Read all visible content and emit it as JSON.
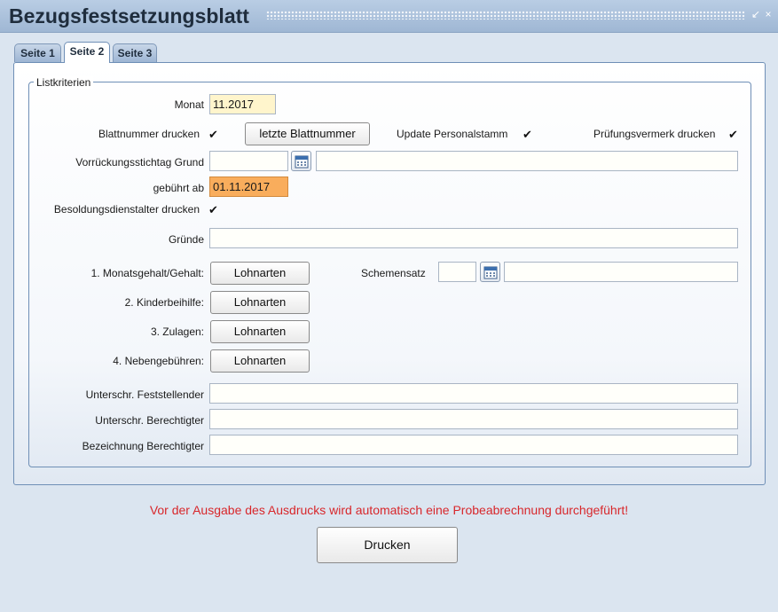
{
  "window": {
    "title": "Bezugsfestsetzungsblatt",
    "restore_glyph": "↙",
    "close_glyph": "×"
  },
  "tabs": [
    {
      "label": "Seite 1",
      "active": false
    },
    {
      "label": "Seite 2",
      "active": true
    },
    {
      "label": "Seite 3",
      "active": false
    }
  ],
  "listkriterien": {
    "legend": "Listkriterien",
    "monat": {
      "label": "Monat",
      "value": "11.2017"
    },
    "blattnummer_drucken": {
      "label": "Blattnummer drucken",
      "checked": true
    },
    "letzte_blattnummer_button": "letzte Blattnummer",
    "update_personalstamm": {
      "label": "Update Personalstamm",
      "checked": true
    },
    "pruefungsvermerk_drucken": {
      "label": "Prüfungsvermerk drucken",
      "checked": true
    },
    "vorrueckungsstichtag_grund": {
      "label": "Vorrückungsstichtag Grund",
      "date_value": "",
      "text_value": ""
    },
    "gebuehrt_ab": {
      "label": "gebührt ab",
      "value": "01.11.2017"
    },
    "besoldungsdienstalter_drucken": {
      "label": "Besoldungsdienstalter drucken",
      "checked": true
    },
    "gruende": {
      "label": "Gründe",
      "value": ""
    },
    "lohnarten_rows": [
      {
        "label": "1. Monatsgehalt/Gehalt:",
        "button": "Lohnarten"
      },
      {
        "label": "2. Kinderbeihilfe:",
        "button": "Lohnarten"
      },
      {
        "label": "3. Zulagen:",
        "button": "Lohnarten"
      },
      {
        "label": "4. Nebengebühren:",
        "button": "Lohnarten"
      }
    ],
    "schemensatz": {
      "label": "Schemensatz",
      "code_value": "",
      "text_value": ""
    },
    "unterschr_feststellender": {
      "label": "Unterschr. Feststellender",
      "value": ""
    },
    "unterschr_berechtigter": {
      "label": "Unterschr. Berechtigter",
      "value": ""
    },
    "bezeichnung_berechtigter": {
      "label": "Bezeichnung Berechtigter",
      "value": ""
    }
  },
  "warning_text": "Vor der Ausgabe des Ausdrucks wird automatisch eine Probeabrechnung durchgeführt!",
  "print_button": "Drucken",
  "colors": {
    "titlebar": "#a9c0dc",
    "highlight_field": "#fff5cc",
    "date_field": "#f9ad5c",
    "warning": "#d8272b"
  },
  "icons": {
    "calendar": "calendar-icon",
    "checkmark": "✔"
  }
}
